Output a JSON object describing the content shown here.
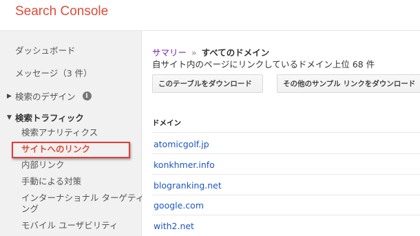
{
  "app": {
    "title": "Search Console"
  },
  "sidebar": {
    "items": [
      {
        "label": "ダッシュボード"
      },
      {
        "label": "メッセージ（3 件）"
      }
    ],
    "sections": [
      {
        "label": "検索のデザイン",
        "expanded": false
      },
      {
        "label": "検索トラフィック",
        "expanded": true
      }
    ],
    "sub_items": [
      {
        "label": "検索アナリティクス"
      },
      {
        "label": "サイトへのリンク",
        "active": true
      },
      {
        "label": "内部リンク"
      },
      {
        "label": "手動による対策"
      },
      {
        "label": "インターナショナル ターゲティ",
        "label_cont": "ング"
      },
      {
        "label": "モバイル ユーザビリティ"
      }
    ]
  },
  "main": {
    "breadcrumb": {
      "link": "サマリー",
      "separator": "»",
      "current": "すべてのドメイン"
    },
    "subtitle": "自サイト内のページにリンクしているドメイン上位 68 件",
    "buttons": {
      "download_table": "このテーブルをダウンロード",
      "download_sample": "その他のサンプル リンクをダウンロード"
    },
    "table": {
      "column_header": "ドメイン",
      "rows": [
        "atomicgolf.jp",
        "konkhmer.info",
        "blogranking.net",
        "google.com",
        "with2.net"
      ]
    }
  },
  "colors": {
    "brand": "#dd4b39",
    "link": "#1a55c4",
    "highlight_border": "#e53935",
    "breadcrumb_link": "#7b1fa2"
  }
}
